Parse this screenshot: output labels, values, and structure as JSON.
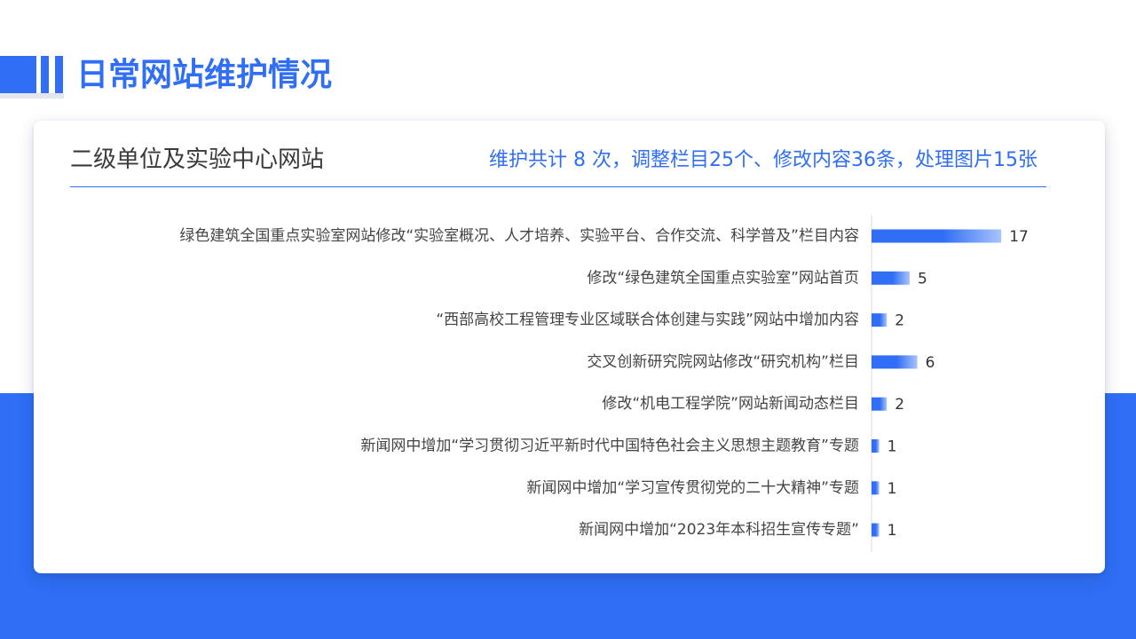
{
  "page": {
    "title": "日常网站维护情况"
  },
  "card": {
    "heading": "二级单位及实验中心网站",
    "summary": "维护共计 8 次，调整栏目25个、修改内容36条，处理图片15张"
  },
  "colors": {
    "accent": "#2f6ef5",
    "bar_start": "#2f6ef5",
    "bar_end": "#a9c3fb",
    "axis": "#d8dbe2"
  },
  "chart_data": {
    "type": "bar",
    "orientation": "horizontal",
    "categories": [
      "绿色建筑全国重点实验室网站修改“实验室概况、人才培养、实验平台、合作交流、科学普及”栏目内容",
      "修改“绿色建筑全国重点实验室”网站首页",
      "“西部高校工程管理专业区域联合体创建与实践”网站中增加内容",
      "交叉创新研究院网站修改“研究机构”栏目",
      "修改“机电工程学院”网站新闻动态栏目",
      "新闻网中增加“学习贯彻习近平新时代中国特色社会主义思想主题教育”专题",
      "新闻网中增加“学习宣传贯彻党的二十大精神”专题",
      "新闻网中增加“2023年本科招生宣传专题”"
    ],
    "values": [
      17,
      5,
      2,
      6,
      2,
      1,
      1,
      1
    ],
    "data_labels": [
      "17",
      "5",
      "2",
      "6",
      "2",
      "1",
      "1",
      "1"
    ],
    "xlim": [
      0,
      20
    ],
    "grid": false,
    "legend": "none"
  }
}
